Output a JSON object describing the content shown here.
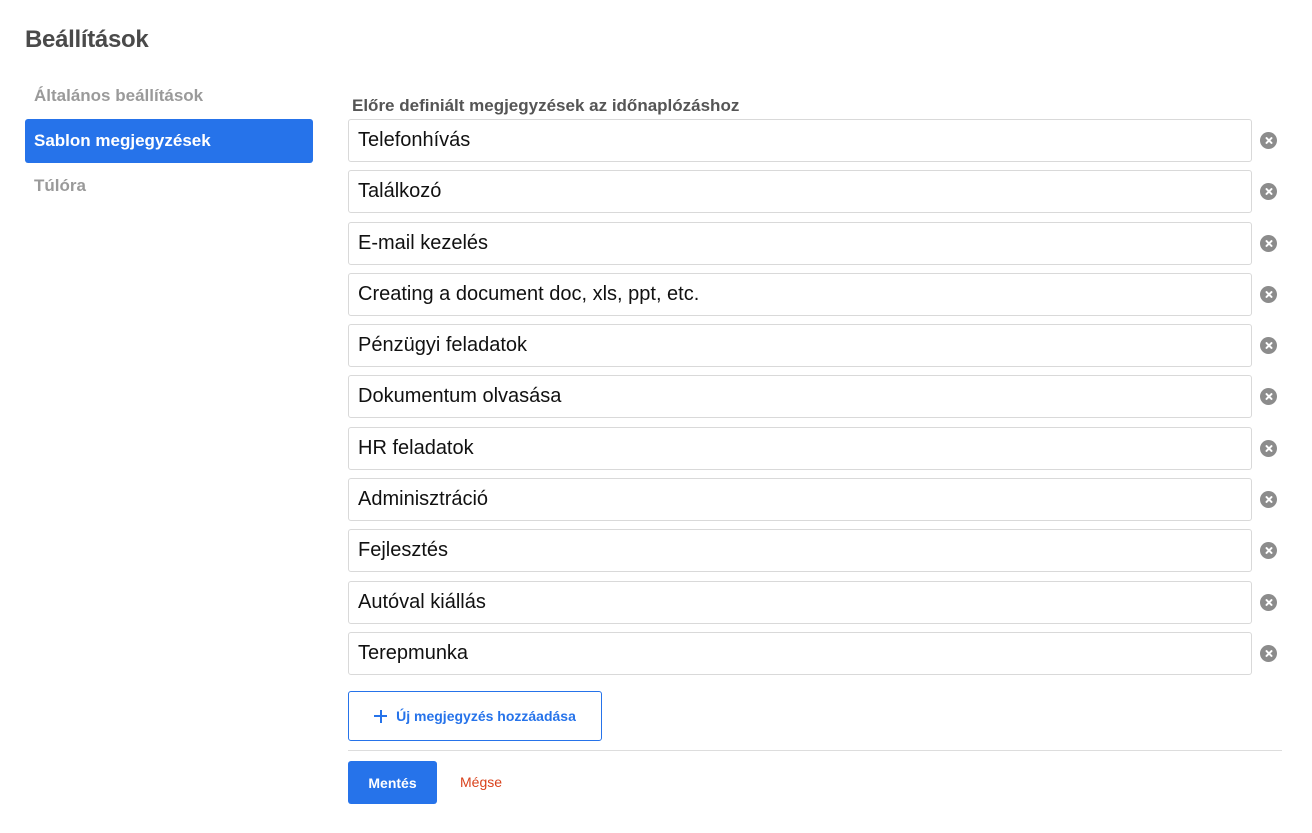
{
  "page": {
    "title": "Beállítások"
  },
  "sidebar": {
    "items": [
      {
        "label": "Általános beállítások",
        "active": false
      },
      {
        "label": "Sablon megjegyzések",
        "active": true
      },
      {
        "label": "Túlóra",
        "active": false
      }
    ]
  },
  "notes": {
    "section_label": "Előre definiált megjegyzések az időnaplózáshoz",
    "items": [
      {
        "value": "Telefonhívás"
      },
      {
        "value": "Találkozó"
      },
      {
        "value": "E-mail kezelés"
      },
      {
        "value": "Creating a document doc, xls, ppt, etc."
      },
      {
        "value": "Pénzügyi feladatok"
      },
      {
        "value": "Dokumentum olvasása"
      },
      {
        "value": "HR feladatok"
      },
      {
        "value": "Adminisztráció"
      },
      {
        "value": "Fejlesztés"
      },
      {
        "value": "Autóval kiállás"
      },
      {
        "value": "Terepmunka"
      }
    ],
    "add_label": "Új megjegyzés hozzáadása"
  },
  "actions": {
    "save_label": "Mentés",
    "cancel_label": "Mégse"
  },
  "colors": {
    "accent": "#2673ea",
    "cancel": "#d9421c",
    "remove_icon": "#8c8c8c"
  },
  "icons": {
    "remove": "close-circle-icon",
    "add": "plus-icon"
  }
}
